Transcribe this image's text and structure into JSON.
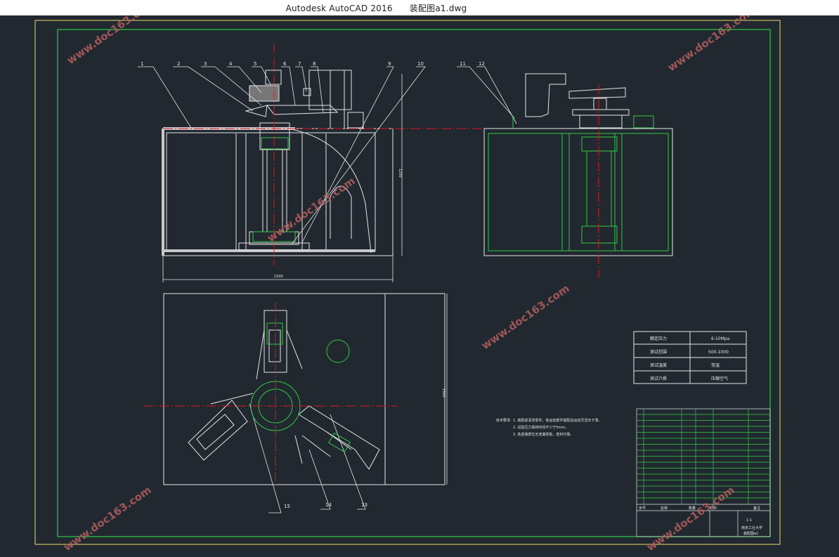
{
  "window": {
    "app_title": "Autodesk AutoCAD 2016",
    "file_name": "装配图a1.dwg"
  },
  "watermark": "www.doc163.com",
  "balloons": [
    "1",
    "2",
    "3",
    "4",
    "5",
    "6",
    "7",
    "8",
    "9",
    "10",
    "11",
    "12",
    "13",
    "14",
    "15"
  ],
  "dimensions": {
    "vertical": "1200",
    "horizontal": "1500",
    "side": "1500"
  },
  "spec_table": {
    "rows": [
      {
        "label": "额定压力",
        "value": "6-10Mpa"
      },
      {
        "label": "测试范围",
        "value": "500-1000"
      },
      {
        "label": "测试温度",
        "value": "常温"
      },
      {
        "label": "测试介质",
        "value": "压缩空气"
      }
    ]
  },
  "tech_notes": {
    "heading": "技术要求:",
    "items": [
      "1. 装配前清洗零件，各运动部件装配后运动灵活无卡滞。",
      "2. 试验压力保持时间不少于5min。",
      "3. 各连接部位无泄漏现象，密封可靠。"
    ]
  },
  "title_block": {
    "school": "南京工业大学",
    "drawing": "装配图a1",
    "scale": "1:1",
    "headers": [
      "序号",
      "名称",
      "数量",
      "材料",
      "备注"
    ]
  },
  "colors": {
    "background": "#212830",
    "line_white": "#e6e6e6",
    "line_green": "#2ecc40",
    "center_red": "#e01818",
    "border_yellow": "#e8e060",
    "watermark": "#b86060"
  }
}
